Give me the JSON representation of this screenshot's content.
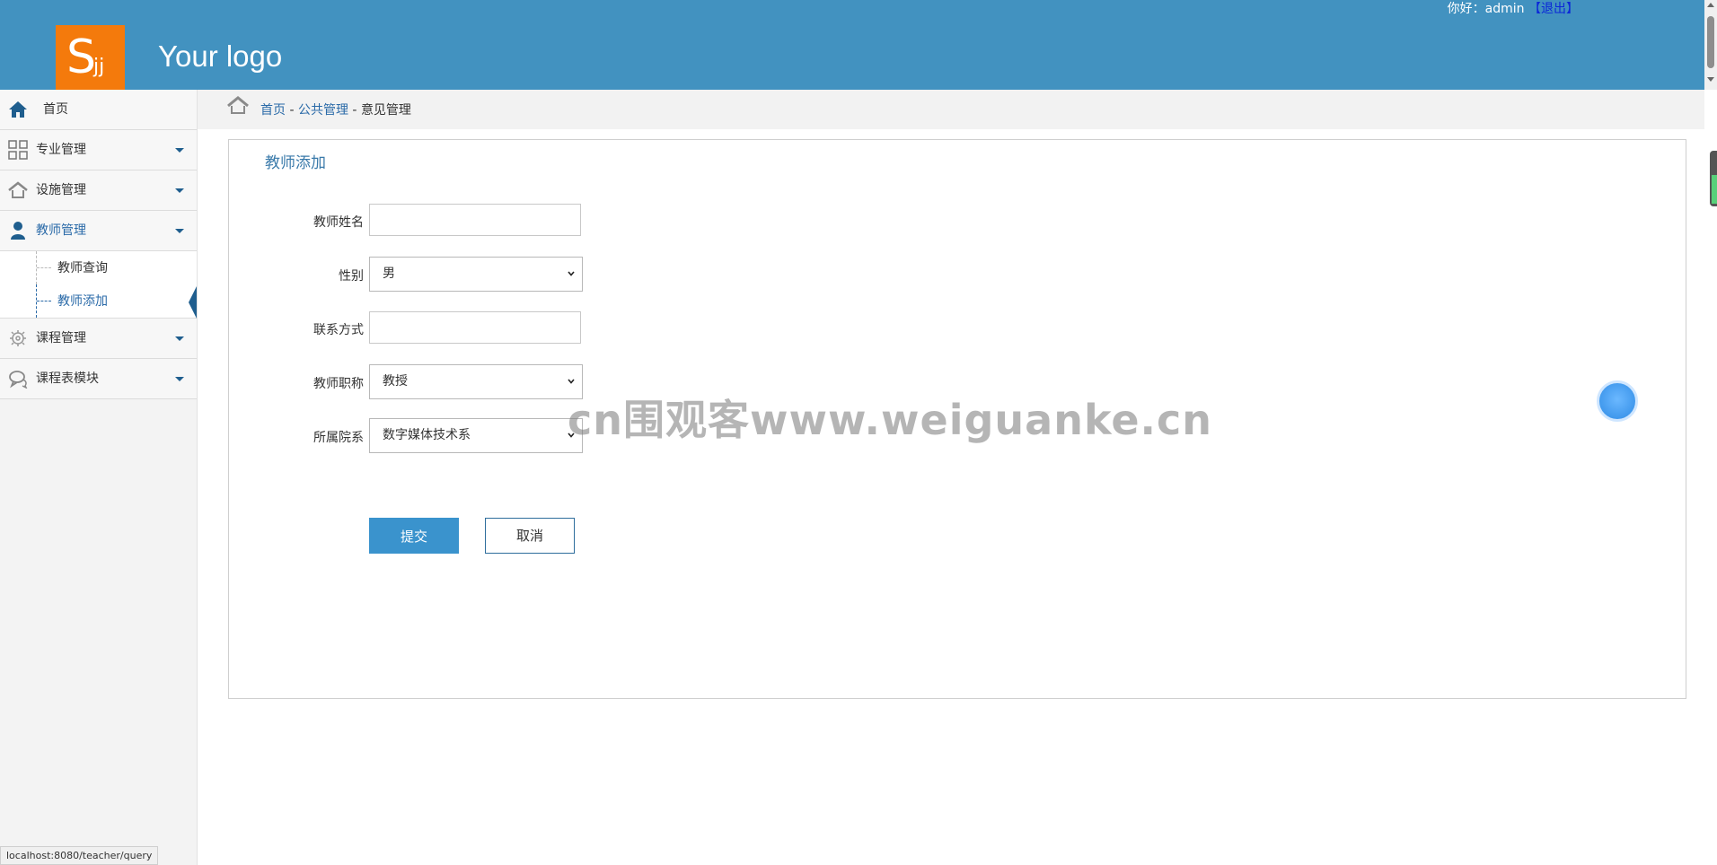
{
  "header": {
    "logo_letter": "S",
    "logo_sub": "jj",
    "logo_text": "Your logo",
    "greeting": "你好：admin",
    "logout_label": "【退出】"
  },
  "sidebar": {
    "home": "首页",
    "items": [
      {
        "label": "专业管理",
        "icon": "grid-icon"
      },
      {
        "label": "设施管理",
        "icon": "house-icon"
      },
      {
        "label": "教师管理",
        "icon": "user-icon"
      },
      {
        "label": "课程管理",
        "icon": "gears-icon"
      },
      {
        "label": "课程表模块",
        "icon": "chat-icon"
      }
    ],
    "sub_items": [
      {
        "label": "教师查询"
      },
      {
        "label": "教师添加"
      }
    ]
  },
  "breadcrumb": {
    "home": "首页",
    "section": "公共管理",
    "current": "意见管理"
  },
  "form": {
    "title": "教师添加",
    "name_label": "教师姓名",
    "name_value": "",
    "gender_label": "性别",
    "gender_value": "男",
    "contact_label": "联系方式",
    "contact_value": "",
    "rank_label": "教师职称",
    "rank_value": "教授",
    "dept_label": "所属院系",
    "dept_value": "数字媒体技术系",
    "submit_label": "提交",
    "cancel_label": "取消"
  },
  "watermark": "cn围观客www.weiguanke.cn",
  "statusbar": "localhost:8080/teacher/query",
  "colors": {
    "header": "#4292c0",
    "logo": "#f47a0c",
    "accent": "#3a93cd",
    "link": "#2a6aa8"
  }
}
